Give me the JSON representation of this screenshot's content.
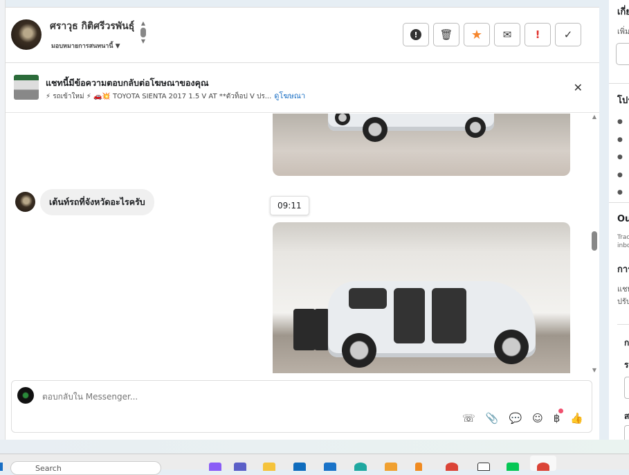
{
  "header": {
    "contact_name": "ศราวุธ กิติศรีวรพันธุ์",
    "assign_label": "มอบหมายการสนทนานี้"
  },
  "actions": [
    {
      "name": "spam",
      "icon": "!"
    },
    {
      "name": "delete",
      "icon": "🗑"
    },
    {
      "name": "star",
      "icon": "★"
    },
    {
      "name": "mark-unread",
      "icon": "✉"
    },
    {
      "name": "follow-up",
      "icon": "!"
    },
    {
      "name": "done",
      "icon": "✓"
    }
  ],
  "ad": {
    "title": "แชทนี้มีข้อความตอบกลับต่อโฆษณาของคุณ",
    "subtitle": "⚡ รถเข้าใหม่ ⚡ 🚗💥 TOYOTA SIENTA 2017 1.5 V AT **ตัวท็อป V ปร...",
    "link": "ดูโฆษณา"
  },
  "messages": {
    "incoming": "เต้นท์รถที่จังหวัดอะไรครับ",
    "timestamp": "09:11"
  },
  "composer": {
    "placeholder": "ตอบกลับใน Messenger..."
  },
  "right_panel": {
    "t1": "เกี่ยวกับ",
    "t2": "เพิ่ม",
    "t3": "โปรไฟล์",
    "t4": "Outcome",
    "t5": "Track",
    "t6": "inbox",
    "t7": "การ",
    "t8": "แชท",
    "t9": "ปรับ",
    "t10": "ก",
    "t11": "ร",
    "t12": "ส"
  },
  "taskbar": {
    "search": "Search"
  },
  "colors": {
    "star": "#f5862d",
    "alert": "#e0312b",
    "link": "#1a6fc4",
    "badge": "#f0506e"
  }
}
